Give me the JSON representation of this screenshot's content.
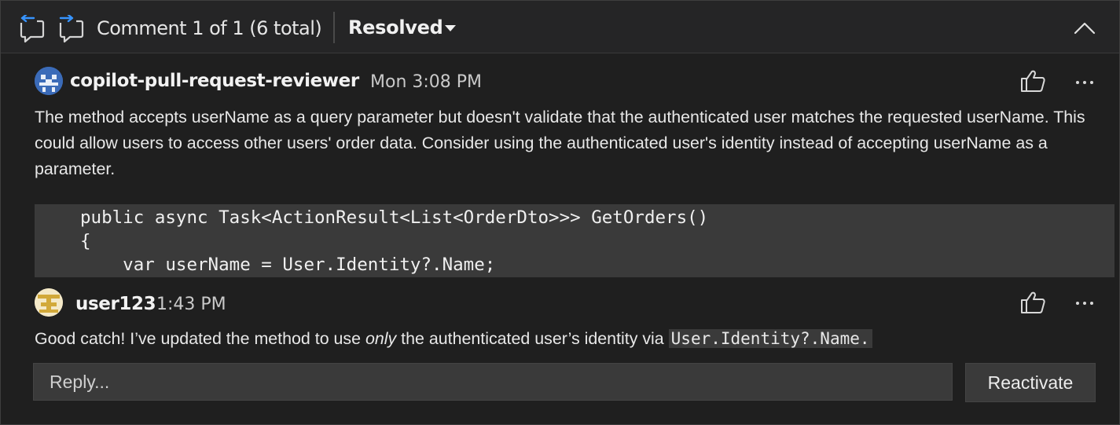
{
  "header": {
    "comment_count": "Comment 1 of 1 (6 total)",
    "status": "Resolved",
    "icons": [
      "previous-comment-icon",
      "next-comment-icon",
      "chevron-up-icon"
    ]
  },
  "comments": [
    {
      "author": "copilot-pull-request-reviewer",
      "time": "Mon 3:08 PM",
      "body": "The method accepts userName as a query parameter but doesn't validate that the authenticated user matches the requested userName. This could allow users to access other users' order data. Consider using the authenticated user's identity instead of accepting userName as a parameter.",
      "code": [
        "public async Task<ActionResult<List<OrderDto>>> GetOrders()",
        "{",
        "    var userName = User.Identity?.Name;"
      ]
    },
    {
      "author": "user123",
      "time": "1:43 PM",
      "body_before": "Good catch! I’ve updated the method to use ",
      "body_emphasis": "only",
      "body_after": " the authenticated user’s identity via ",
      "body_code": "User.Identity?.Name."
    }
  ],
  "reply": {
    "placeholder": "Reply...",
    "action_label": "Reactivate"
  },
  "colors": {
    "background": "#1f1f1f",
    "header_background": "#252526",
    "code_background": "#3a3a3a",
    "nav_icon_accent": "#3794ff",
    "copilot_avatar": "#3b6bb8",
    "user_avatar": "#d2a93a"
  }
}
